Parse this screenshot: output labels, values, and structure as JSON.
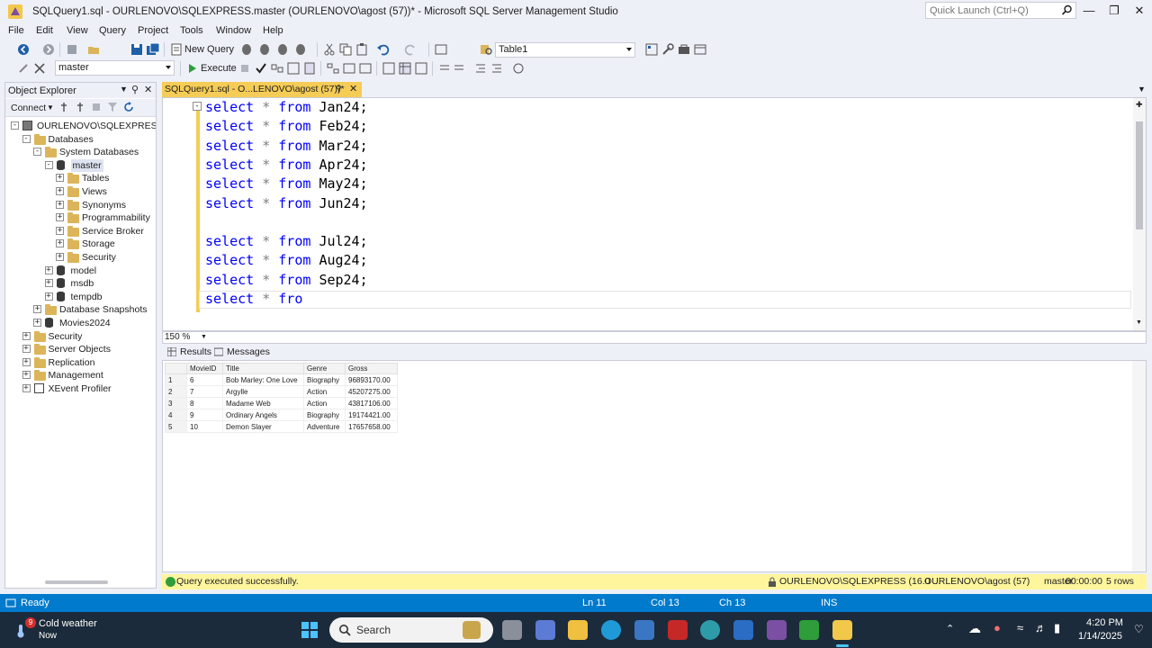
{
  "window": {
    "title": "SQLQuery1.sql - OURLENOVO\\SQLEXPRESS.master (OURLENOVO\\agost (57))* - Microsoft SQL Server Management Studio",
    "quick_launch_placeholder": "Quick Launch (Ctrl+Q)"
  },
  "menu": [
    "File",
    "Edit",
    "View",
    "Query",
    "Project",
    "Tools",
    "Window",
    "Help"
  ],
  "toolbar": {
    "new_query_label": "New Query",
    "table_combo": "Table1",
    "database_combo": "master",
    "execute_label": "Execute"
  },
  "object_explorer": {
    "title": "Object Explorer",
    "connect_label": "Connect",
    "tree": [
      {
        "label": "OURLENOVO\\SQLEXPRESS (SQ",
        "level": 0,
        "icon": "server",
        "expander": "-"
      },
      {
        "label": "Databases",
        "level": 1,
        "icon": "folder",
        "expander": "-"
      },
      {
        "label": "System Databases",
        "level": 2,
        "icon": "folder",
        "expander": "-"
      },
      {
        "label": "master",
        "level": 3,
        "icon": "db",
        "expander": "-",
        "selected": true
      },
      {
        "label": "Tables",
        "level": 4,
        "icon": "folder",
        "expander": "+"
      },
      {
        "label": "Views",
        "level": 4,
        "icon": "folder",
        "expander": "+"
      },
      {
        "label": "Synonyms",
        "level": 4,
        "icon": "folder",
        "expander": "+"
      },
      {
        "label": "Programmability",
        "level": 4,
        "icon": "folder",
        "expander": "+"
      },
      {
        "label": "Service Broker",
        "level": 4,
        "icon": "folder",
        "expander": "+"
      },
      {
        "label": "Storage",
        "level": 4,
        "icon": "folder",
        "expander": "+"
      },
      {
        "label": "Security",
        "level": 4,
        "icon": "folder",
        "expander": "+"
      },
      {
        "label": "model",
        "level": 3,
        "icon": "db",
        "expander": "+"
      },
      {
        "label": "msdb",
        "level": 3,
        "icon": "db",
        "expander": "+"
      },
      {
        "label": "tempdb",
        "level": 3,
        "icon": "db",
        "expander": "+"
      },
      {
        "label": "Database Snapshots",
        "level": 2,
        "icon": "folder",
        "expander": "+"
      },
      {
        "label": "Movies2024",
        "level": 2,
        "icon": "db",
        "expander": "+"
      },
      {
        "label": "Security",
        "level": 1,
        "icon": "folder",
        "expander": "+"
      },
      {
        "label": "Server Objects",
        "level": 1,
        "icon": "folder",
        "expander": "+"
      },
      {
        "label": "Replication",
        "level": 1,
        "icon": "folder",
        "expander": "+"
      },
      {
        "label": "Management",
        "level": 1,
        "icon": "folder",
        "expander": "+"
      },
      {
        "label": "XEvent Profiler",
        "level": 1,
        "icon": "xevent",
        "expander": "+"
      }
    ]
  },
  "doc_tab": {
    "label": "SQLQuery1.sql - O...LENOVO\\agost (57))*"
  },
  "editor": {
    "lines": [
      {
        "kw": "select",
        "star": "*",
        "from": "from",
        "table": "Jan24;"
      },
      {
        "kw": "select",
        "star": "*",
        "from": "from",
        "table": "Feb24;"
      },
      {
        "kw": "select",
        "star": "*",
        "from": "from",
        "table": "Mar24;"
      },
      {
        "kw": "select",
        "star": "*",
        "from": "from",
        "table": "Apr24;"
      },
      {
        "kw": "select",
        "star": "*",
        "from": "from",
        "table": "May24;"
      },
      {
        "kw": "select",
        "star": "*",
        "from": "from",
        "table": "Jun24;"
      },
      {
        "kw": "",
        "star": "",
        "from": "",
        "table": ""
      },
      {
        "kw": "select",
        "star": "*",
        "from": "from",
        "table": "Jul24;"
      },
      {
        "kw": "select",
        "star": "*",
        "from": "from",
        "table": "Aug24;"
      },
      {
        "kw": "select",
        "star": "*",
        "from": "from",
        "table": "Sep24;"
      },
      {
        "kw": "select",
        "star": "*",
        "from": "fro",
        "table": ""
      }
    ],
    "zoom": "150 %"
  },
  "results": {
    "tabs": [
      "Results",
      "Messages"
    ],
    "columns": [
      "MovieID",
      "Title",
      "Genre",
      "Gross"
    ],
    "rows": [
      [
        "1",
        "6",
        "Bob Marley: One Love",
        "Biography",
        "96893170.00"
      ],
      [
        "2",
        "7",
        "Argylle",
        "Action",
        "45207275.00"
      ],
      [
        "3",
        "8",
        "Madame Web",
        "Action",
        "43817106.00"
      ],
      [
        "4",
        "9",
        "Ordinary Angels",
        "Biography",
        "19174421.00"
      ],
      [
        "5",
        "10",
        "Demon Slayer",
        "Adventure",
        "17657658.00"
      ]
    ]
  },
  "query_status": {
    "message": "Query executed successfully.",
    "server": "OURLENOVO\\SQLEXPRESS (16.0 ...",
    "user": "OURLENOVO\\agost (57)",
    "database": "master",
    "elapsed": "00:00:00",
    "rows": "5 rows"
  },
  "status_bar": {
    "ready": "Ready",
    "ln": "Ln 11",
    "col": "Col 13",
    "ch": "Ch 13",
    "ins": "INS"
  },
  "taskbar": {
    "weather_badge": "9",
    "weather_title": "Cold weather",
    "weather_sub": "Now",
    "search_label": "Search",
    "time": "4:20 PM",
    "date": "1/14/2025"
  },
  "colors": {
    "accent_blue": "#007acc",
    "tab_yellow": "#f5cc56",
    "keyword_blue": "#0000ff",
    "status_yellow": "#fff59d"
  }
}
